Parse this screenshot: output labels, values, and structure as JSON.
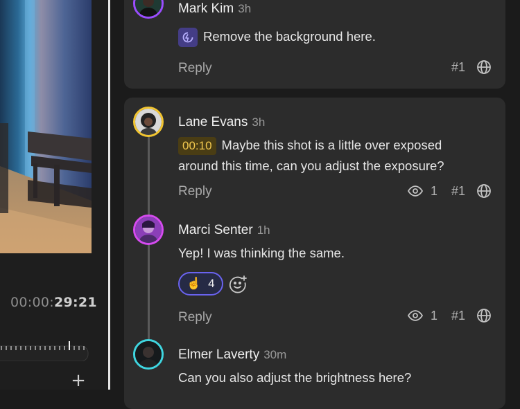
{
  "video": {
    "timecode_dim": "00:00:",
    "timecode_main": "29:21"
  },
  "comments": [
    {
      "author": "Mark Kim",
      "time": "3h",
      "text": "Remove the background here.",
      "reply_label": "Reply",
      "version": "#1",
      "avatar_ring": "#9b4dff",
      "icon": "remove-background-icon"
    },
    {
      "author": "Lane Evans",
      "time": "3h",
      "timestamp": "00:10",
      "text": "Maybe this shot is a little over exposed around this time, can you adjust the exposure?",
      "reply_label": "Reply",
      "views": "1",
      "version": "#1",
      "avatar_ring": "#f2c530"
    },
    {
      "author": "Marci Senter",
      "time": "1h",
      "text": "Yep! I was thinking the same.",
      "reaction_emoji": "☝️",
      "reaction_count": "4",
      "reply_label": "Reply",
      "views": "1",
      "version": "#1",
      "avatar_ring": "#d64bf0"
    },
    {
      "author": "Elmer Laverty",
      "time": "30m",
      "text": "Can you also adjust the brightness here?",
      "avatar_ring": "#3fd6e0"
    }
  ],
  "colors": {
    "panel": "#2c2c2c",
    "background": "#1b1b1b",
    "timestamp_badge": "#4a3d14",
    "timestamp_text": "#f1c84f",
    "reaction_border": "#6a63f0"
  }
}
